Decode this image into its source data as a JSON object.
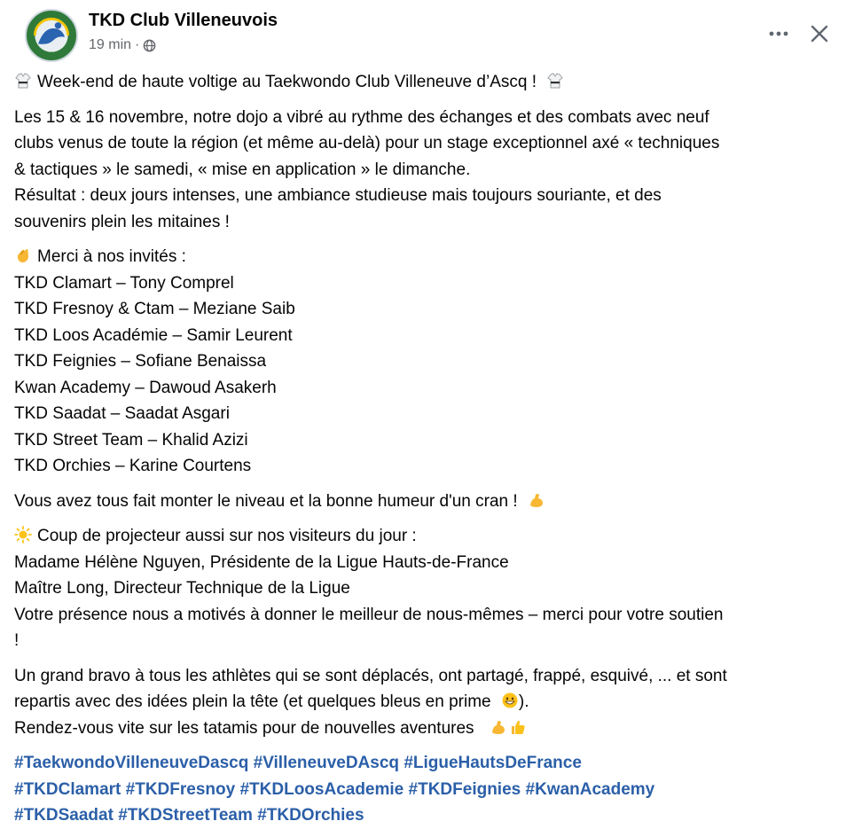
{
  "post": {
    "author": "TKD Club Villeneuvois",
    "time": "19 min",
    "separator": "·",
    "icons": {
      "avatar": "club-logo",
      "privacy": "globe-icon",
      "more": "more-options-icon",
      "close": "close-icon"
    },
    "colors": {
      "text": "#050505",
      "meta": "#65676b",
      "hashtag": "#2b5fa8"
    },
    "title_line": "Week-end de haute voltige au Taekwondo Club Villeneuve d’Ascq !",
    "intro": {
      "line1": "Les 15 & 16 novembre, notre dojo a vibré au rythme des échanges et des combats avec neuf",
      "line2": "clubs venus de toute la région (et même au-delà) pour un stage exceptionnel axé « techniques",
      "line3": "& tactiques » le samedi, « mise en application » le dimanche.",
      "line4": "Résultat : deux jours intenses, une ambiance studieuse mais toujours souriante, et des",
      "line5": "souvenirs plein les mitaines !"
    },
    "guests_heading": "Merci à nos invités :",
    "guests": [
      "TKD Clamart – Tony Comprel",
      "TKD Fresnoy & Ctam – Meziane Saib",
      "TKD Loos Académie – Samir Leurent",
      "TKD Feignies – Sofiane Benaissa",
      "Kwan Academy – Dawoud Asakerh",
      "TKD Saadat – Saadat Asgari",
      "TKD Street Team – Khalid Azizi",
      "TKD Orchies – Karine Courtens"
    ],
    "level_line": "Vous avez tous fait monter le niveau et la bonne humeur d'un cran !",
    "visitors": {
      "heading": "Coup de projecteur aussi sur nos visiteurs du jour :",
      "line1": "Madame Hélène Nguyen, Présidente de la Ligue Hauts-de-France",
      "line2": "Maître Long, Directeur Technique de la Ligue",
      "line3": "Votre présence nous a motivés à donner le meilleur de nous-mêmes – merci pour votre soutien",
      "line4": "!"
    },
    "closing": {
      "line1": "Un grand bravo à tous les athlètes qui se sont déplacés, ont partagé, frappé, esquivé, ... et sont",
      "line2": "repartis avec des idées plein la tête (et quelques bleus en prime",
      "line2_end": ").",
      "line3": "Rendez-vous vite sur les tatamis pour de nouvelles aventures"
    },
    "hashtags": {
      "row1": [
        "#TaekwondoVilleneuveDascq",
        "#VilleneuveDAscq",
        "#LigueHautsDeFrance"
      ],
      "row2": [
        "#TKDClamart",
        "#TKDFresnoy",
        "#TKDLoosAcademie",
        "#TKDFeignies",
        "#KwanAcademy"
      ],
      "row3": [
        "#TKDSaadat",
        "#TKDStreetTeam",
        "#TKDOrchies"
      ]
    }
  }
}
